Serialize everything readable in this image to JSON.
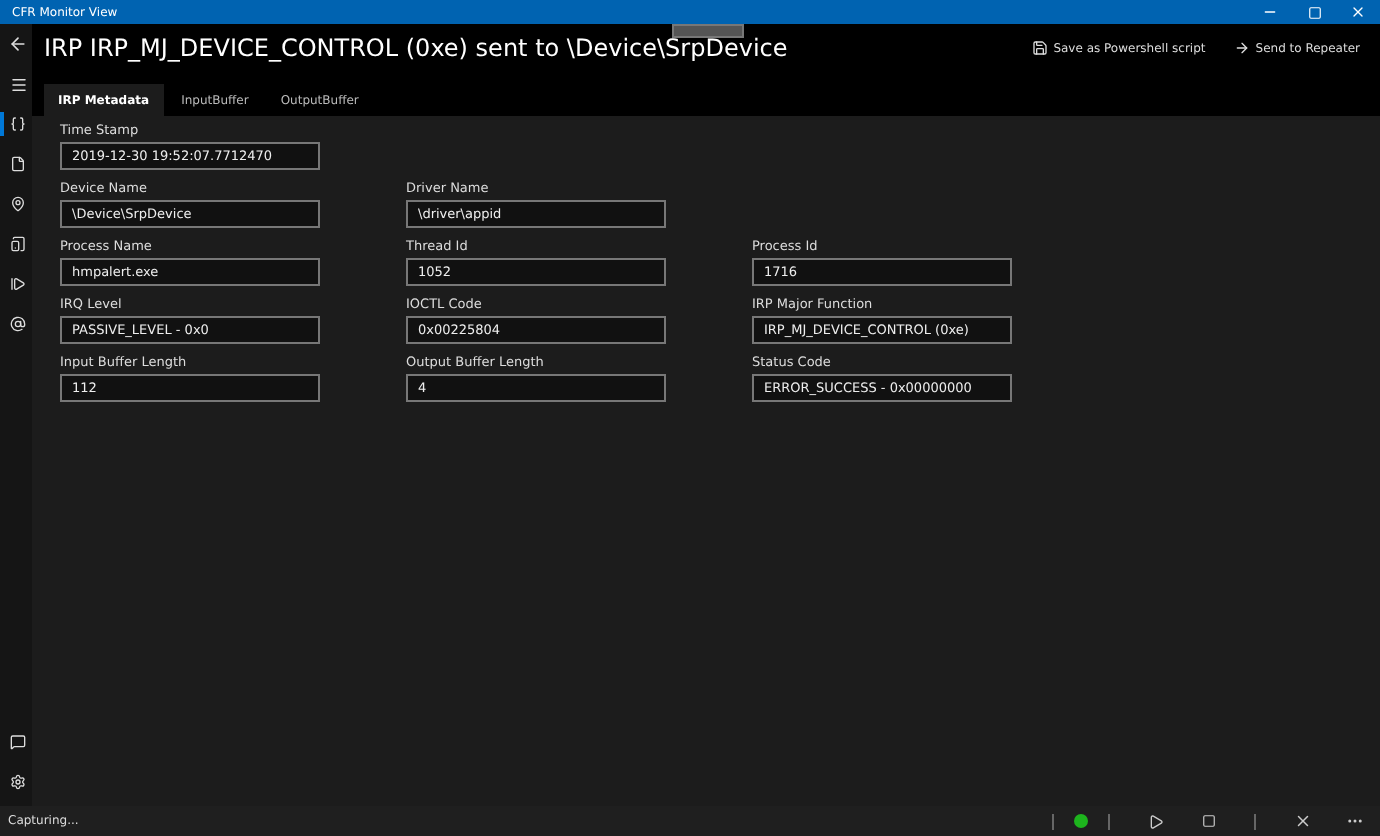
{
  "window": {
    "title": "CFR Monitor View"
  },
  "header": {
    "title": "IRP IRP_MJ_DEVICE_CONTROL (0xe) sent to \\Device\\SrpDevice",
    "actions": [
      {
        "kind": "save",
        "label": "Save as Powershell script"
      },
      {
        "kind": "send",
        "label": "Send to Repeater"
      }
    ]
  },
  "sidebar": {
    "items": [
      {
        "kind": "braces",
        "selected": true
      },
      {
        "kind": "file",
        "selected": false
      },
      {
        "kind": "pin",
        "selected": false
      },
      {
        "kind": "device",
        "selected": false
      },
      {
        "kind": "step",
        "selected": false
      },
      {
        "kind": "at",
        "selected": false
      }
    ],
    "bottom": [
      {
        "kind": "comment"
      },
      {
        "kind": "settings"
      }
    ]
  },
  "tabs": [
    {
      "label": "IRP Metadata",
      "selected": true
    },
    {
      "label": "InputBuffer",
      "selected": false
    },
    {
      "label": "OutputBuffer",
      "selected": false
    }
  ],
  "field_rows": [
    [
      {
        "label": "Time Stamp",
        "value": "2019-12-30 19:52:07.7712470"
      }
    ],
    [
      {
        "label": "Device Name",
        "value": "\\Device\\SrpDevice"
      },
      {
        "label": "Driver Name",
        "value": "\\driver\\appid"
      }
    ],
    [
      {
        "label": "Process Name",
        "value": "hmpalert.exe"
      },
      {
        "label": "Thread Id",
        "value": "1052"
      },
      {
        "label": "Process Id",
        "value": "1716"
      }
    ],
    [
      {
        "label": "IRQ Level",
        "value": "PASSIVE_LEVEL - 0x0"
      },
      {
        "label": "IOCTL Code",
        "value": "0x00225804"
      },
      {
        "label": "IRP Major Function",
        "value": "IRP_MJ_DEVICE_CONTROL (0xe)"
      }
    ],
    [
      {
        "label": "Input Buffer Length",
        "value": "112"
      },
      {
        "label": "Output Buffer Length",
        "value": "4"
      },
      {
        "label": "Status Code",
        "value": "ERROR_SUCCESS - 0x00000000"
      }
    ]
  ],
  "status_bar": {
    "text": "Capturing...",
    "capturing": true
  }
}
